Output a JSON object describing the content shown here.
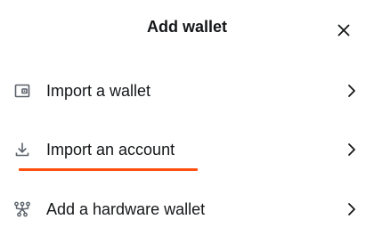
{
  "dialog": {
    "title": "Add wallet",
    "close_icon": "close-icon",
    "options": [
      {
        "label": "Import a wallet",
        "icon": "wallet-icon"
      },
      {
        "label": "Import an account",
        "icon": "download-icon",
        "highlighted": true
      },
      {
        "label": "Add a hardware wallet",
        "icon": "hardware-wallet-icon"
      }
    ],
    "chevron_icon": "chevron-right-icon"
  },
  "colors": {
    "text": "#141618",
    "icon": "#5a6169",
    "accent_underline": "#ff4f0f",
    "background": "#ffffff"
  }
}
